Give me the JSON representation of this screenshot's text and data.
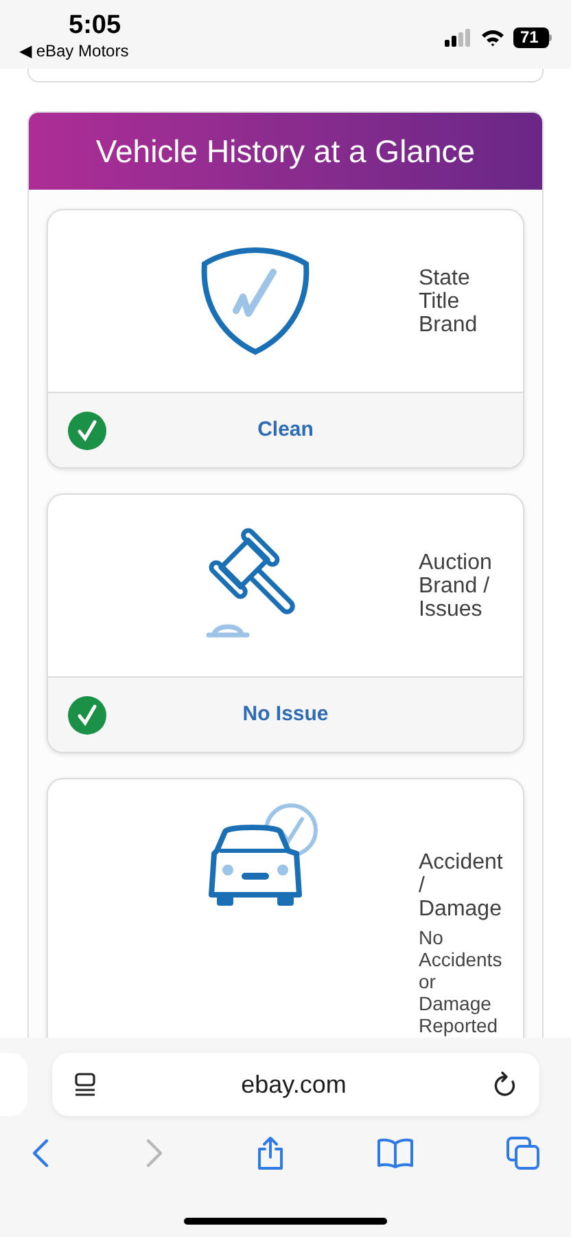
{
  "status_bar": {
    "time": "5:05",
    "back_app": "◀ eBay Motors",
    "battery": "71"
  },
  "panel": {
    "title": "Vehicle History at a Glance",
    "cards": [
      {
        "kind": "status",
        "title": "State Title Brand",
        "result": "Clean",
        "ok": true
      },
      {
        "kind": "status",
        "title": "Auction Brand / Issues",
        "result": "No Issue",
        "ok": true
      },
      {
        "kind": "detail",
        "title": "Accident / Damage",
        "detail": "No Accidents or Damage Reported"
      }
    ]
  },
  "browser": {
    "address": "ebay.com",
    "forward_disabled": true
  }
}
